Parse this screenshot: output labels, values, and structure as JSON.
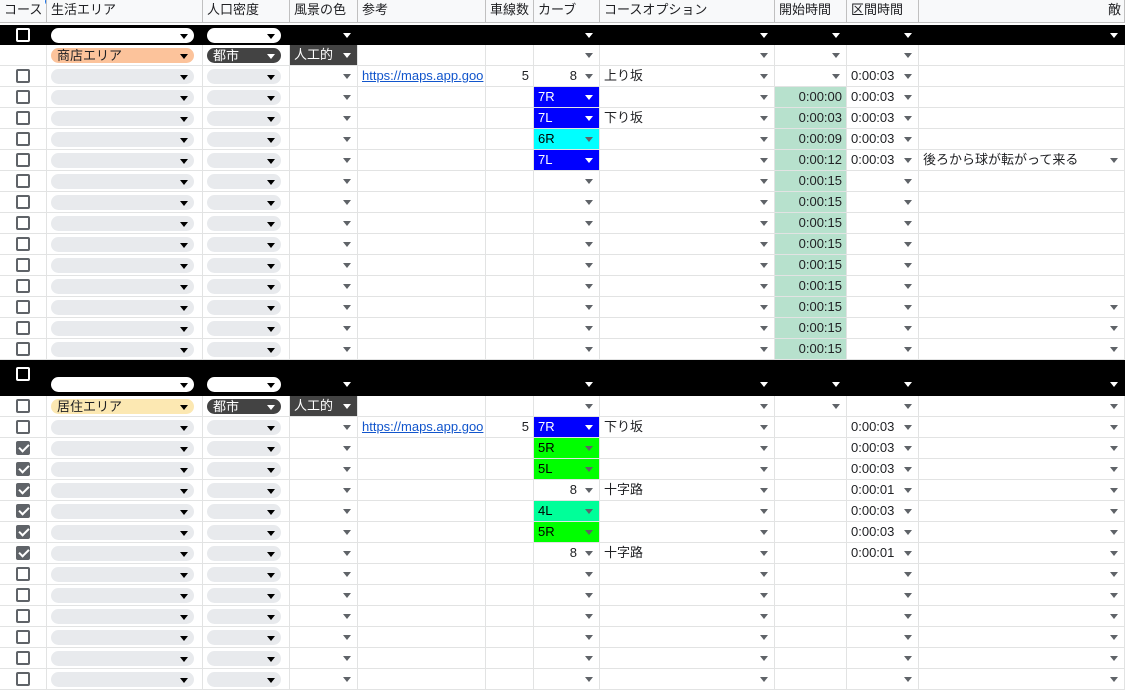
{
  "columns": [
    {
      "key": "course",
      "label": "コース"
    },
    {
      "key": "area",
      "label": "生活エリア"
    },
    {
      "key": "density",
      "label": "人口密度"
    },
    {
      "key": "scenery",
      "label": "風景の色"
    },
    {
      "key": "ref",
      "label": "参考"
    },
    {
      "key": "lanes",
      "label": "車線数"
    },
    {
      "key": "curve",
      "label": "カーブ"
    },
    {
      "key": "option",
      "label": "コースオプション"
    },
    {
      "key": "start",
      "label": "開始時間"
    },
    {
      "key": "interval",
      "label": "区間時間"
    },
    {
      "key": "enemy",
      "label": "敵"
    }
  ],
  "colors": {
    "area_shop": "#fcc39b",
    "area_residential": "#fce8b2",
    "chip_default": "#e8eaed",
    "dark_tag": "#434343",
    "curve_blue": "#0000ff",
    "curve_cyan": "#00ffff",
    "curve_green": "#00ff00",
    "curve_mint": "#00ff99",
    "start_time_bg": "#b7e1cd"
  },
  "rows": [
    {
      "type": "sep"
    },
    {
      "area": "商店エリア",
      "areaColor": "#fcc39b",
      "density": "都市",
      "scenery": "人工的"
    },
    {
      "check": false,
      "ref": "https://maps.app.goo",
      "lanes": "5",
      "curveNum": "8",
      "option": "上り坂",
      "interval": "0:00:03"
    },
    {
      "check": false,
      "curve": "7R",
      "curveColor": "blue",
      "start": "0:00:00",
      "interval": "0:00:03"
    },
    {
      "check": false,
      "curve": "7L",
      "curveColor": "blue",
      "option": "下り坂",
      "start": "0:00:03",
      "interval": "0:00:03"
    },
    {
      "check": false,
      "curve": "6R",
      "curveColor": "cyan",
      "start": "0:00:09",
      "interval": "0:00:03"
    },
    {
      "check": false,
      "curve": "7L",
      "curveColor": "blue",
      "start": "0:00:12",
      "interval": "0:00:03",
      "enemy": "後ろから球が転がって来る"
    },
    {
      "check": false,
      "start": "0:00:15"
    },
    {
      "check": false,
      "start": "0:00:15"
    },
    {
      "check": false,
      "start": "0:00:15"
    },
    {
      "check": false,
      "start": "0:00:15"
    },
    {
      "check": false,
      "start": "0:00:15"
    },
    {
      "check": false,
      "start": "0:00:15"
    },
    {
      "check": false,
      "start": "0:00:15"
    },
    {
      "check": false,
      "start": "0:00:15"
    },
    {
      "check": false,
      "start": "0:00:15"
    },
    {
      "type": "sep2"
    },
    {
      "check": false,
      "area": "居住エリア",
      "areaColor": "#fce8b2",
      "density": "都市",
      "scenery": "人工的"
    },
    {
      "check": false,
      "ref": "https://maps.app.goo",
      "lanes": "5",
      "curve": "7R",
      "curveColor": "blue",
      "option": "下り坂",
      "interval": "0:00:03"
    },
    {
      "check": true,
      "curve": "5R",
      "curveColor": "green",
      "interval": "0:00:03"
    },
    {
      "check": true,
      "curve": "5L",
      "curveColor": "green",
      "interval": "0:00:03"
    },
    {
      "check": true,
      "curveNum": "8",
      "option": "十字路",
      "interval": "0:00:01"
    },
    {
      "check": true,
      "curve": "4L",
      "curveColor": "mint",
      "interval": "0:00:03"
    },
    {
      "check": true,
      "curve": "5R",
      "curveColor": "green",
      "interval": "0:00:03"
    },
    {
      "check": true,
      "curveNum": "8",
      "option": "十字路",
      "interval": "0:00:01"
    },
    {
      "check": false
    },
    {
      "check": false
    },
    {
      "check": false
    },
    {
      "check": false
    },
    {
      "check": false
    },
    {
      "check": false
    }
  ]
}
